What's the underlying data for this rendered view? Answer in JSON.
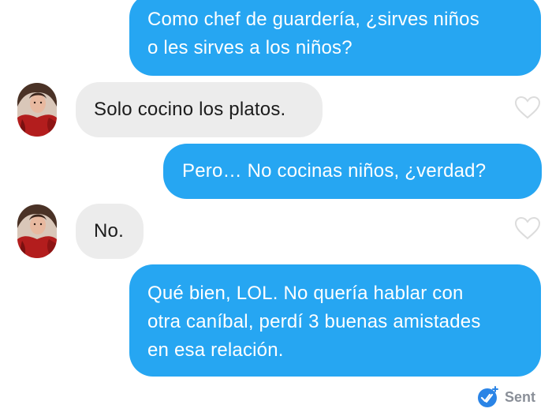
{
  "messages": [
    {
      "id": "msg1",
      "sender": "me",
      "lines": [
        "Como chef de guardería, ¿sirves niños",
        "o les sirves a los niños?"
      ]
    },
    {
      "id": "msg2",
      "sender": "them",
      "lines": [
        "Solo cocino los platos."
      ]
    },
    {
      "id": "msg3",
      "sender": "me",
      "lines": [
        "Pero… No cocinas niños, ¿verdad?"
      ]
    },
    {
      "id": "msg4",
      "sender": "them",
      "lines": [
        "No."
      ]
    },
    {
      "id": "msg5",
      "sender": "me",
      "lines": [
        "Qué bien, LOL. No quería hablar con",
        "otra caníbal, perdí 3 buenas amistades",
        "en esa relación."
      ]
    }
  ],
  "status": {
    "label": "Sent",
    "icon": "double-check-icon"
  },
  "icons": {
    "like": "heart-outline-icon",
    "avatar": "contact-avatar"
  },
  "colors": {
    "outgoing_bubble": "#26a6f2",
    "incoming_bubble": "#ececec",
    "status_text": "#8a8f98",
    "check_badge": "#2a84e6"
  }
}
